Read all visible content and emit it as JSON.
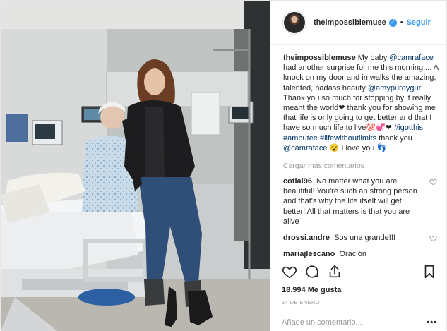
{
  "header": {
    "username": "theimpossiblemuse",
    "separator": "•",
    "follow_label": "Seguir"
  },
  "caption": {
    "username": "theimpossiblemuse",
    "part1": "My baby ",
    "mention1": "@camraface",
    "part2": " had another surprise for me this morning.... A knock on my door and in walks the amazing, talented, badass beauty ",
    "mention2": "@amypurdygurl",
    "part3": " Thank you so much for stopping by it really meant the world❤ thank you for showing me that life is only going to get better and that I have so much life to live💯💞❤ ",
    "hashtag1": "#igotthis",
    "hashtag2": "#amputee",
    "hashtag3": "#lifewithoutlimits",
    "part4": " thank you ",
    "mention3": "@camraface",
    "part5": " 😵 I love you 👣"
  },
  "load_more": "Cargar más comentarios",
  "comments": [
    {
      "username": "cotial96",
      "text": "No matter what you are beautiful! You're such an strong person and that's why the life itself will get better! All that matters is that you are alive"
    },
    {
      "username": "drossi.andre",
      "text": "Sos una grande!!!"
    },
    {
      "username": "mariajlescano",
      "text": "Oración"
    }
  ],
  "actions": {
    "icons": [
      "heart-icon",
      "comment-icon",
      "share-icon",
      "bookmark-icon"
    ]
  },
  "likes": "18.994 Me gusta",
  "date": "14 DE ENERO",
  "add_comment": {
    "placeholder": "Añade un comentario...",
    "more": "•••"
  },
  "colors": {
    "link": "#003569",
    "accent": "#3897f0",
    "muted": "#999999"
  }
}
